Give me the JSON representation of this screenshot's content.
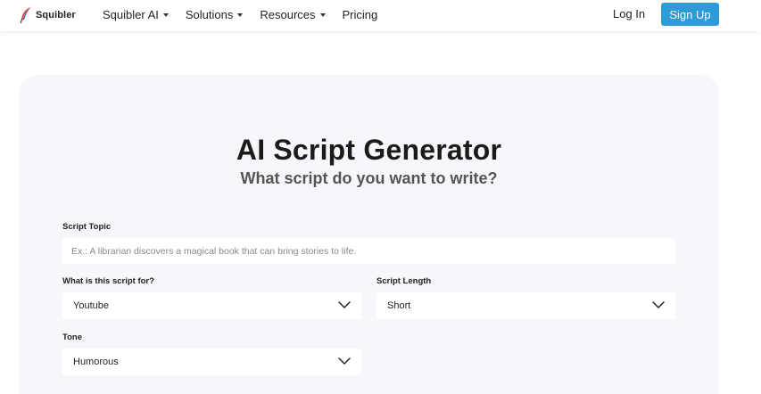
{
  "brand": {
    "name": "Squibler",
    "feather_color": "#e2453c"
  },
  "nav": {
    "items": [
      {
        "label": "Squibler AI",
        "has_dropdown": true
      },
      {
        "label": "Solutions",
        "has_dropdown": true
      },
      {
        "label": "Resources",
        "has_dropdown": true
      },
      {
        "label": "Pricing",
        "has_dropdown": false
      }
    ],
    "login": "Log In",
    "signup": "Sign Up",
    "signup_color": "#2f9ad8"
  },
  "main": {
    "title": "AI Script Generator",
    "subtitle": "What script do you want to write?",
    "topic": {
      "label": "Script Topic",
      "placeholder": "Ex.: A librarian discovers a magical book that can bring stories to life."
    },
    "purpose": {
      "label": "What is this script for?",
      "value": "Youtube"
    },
    "length": {
      "label": "Script Length",
      "value": "Short"
    },
    "tone": {
      "label": "Tone",
      "value": "Humorous"
    }
  }
}
